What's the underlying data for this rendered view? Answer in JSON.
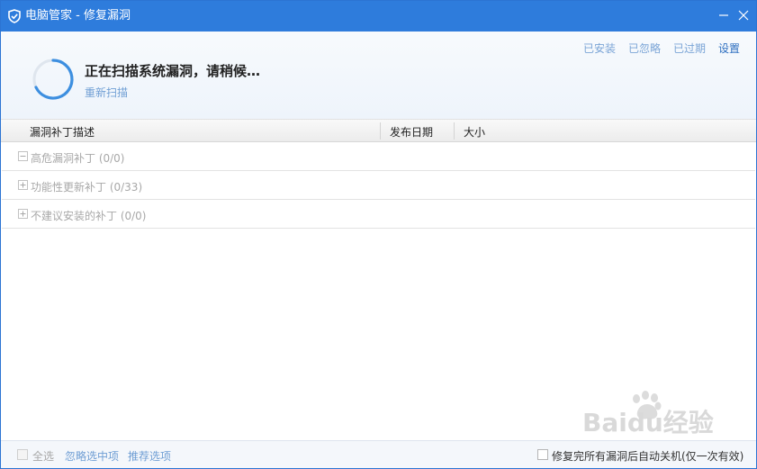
{
  "window": {
    "title": "电脑管家 - 修复漏洞"
  },
  "top_links": [
    "已安装",
    "已忽略",
    "已过期",
    "设置"
  ],
  "scan": {
    "status": "正在扫描系统漏洞，请稍候…",
    "rescan_label": "重新扫描"
  },
  "columns": {
    "desc": "漏洞补丁描述",
    "date": "发布日期",
    "size": "大小"
  },
  "groups": [
    {
      "label": "高危漏洞补丁 (0/0)",
      "expanded": true
    },
    {
      "label": "功能性更新补丁 (0/33)",
      "expanded": false
    },
    {
      "label": "不建议安装的补丁 (0/0)",
      "expanded": false
    }
  ],
  "footer": {
    "select_all": "全选",
    "ignore_selected": "忽略选中项",
    "recommended": "推荐选项",
    "auto_shutdown": "修复完所有漏洞后自动关机(仅一次有效)"
  },
  "colors": {
    "titlebar": "#2e7cdc",
    "link": "#6f9ed4",
    "spinner": "#3d8fe0"
  },
  "watermark": {
    "text": "Baidu经验"
  }
}
